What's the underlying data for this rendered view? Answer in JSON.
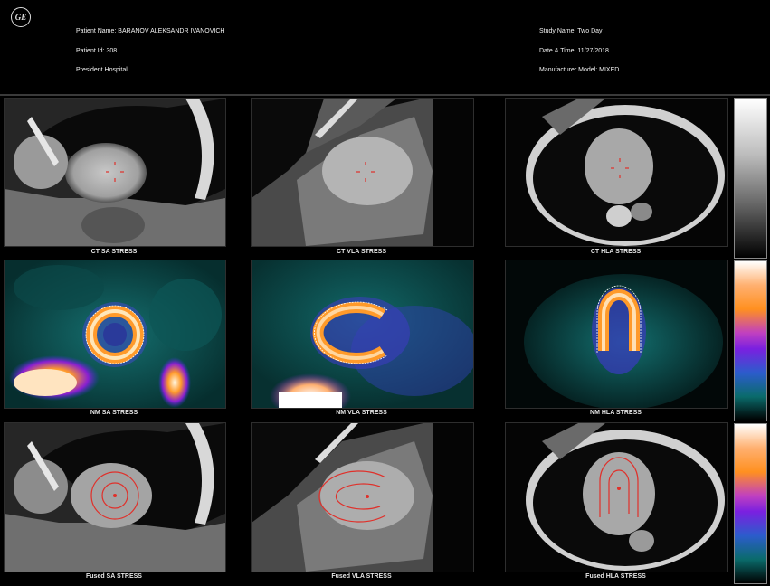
{
  "header": {
    "logo_text": "GE",
    "patient_name": "Patient Name: BARANOV ALEKSANDR IVANOVICH",
    "patient_id": "Patient Id: 308",
    "hospital": "President Hospital",
    "study_name": "Study Name: Two Day",
    "date_time": "Date & Time: 11/27/2018",
    "manufacturer_model": "Manufacturer Model: MIXED"
  },
  "viewports": {
    "ct_sa": "CT SA STRESS",
    "ct_vla": "CT VLA STRESS",
    "ct_hla": "CT HLA STRESS",
    "nm_sa": "NM SA STRESS",
    "nm_vla": "NM VLA STRESS",
    "nm_hla": "NM HLA STRESS",
    "fused_sa": "Fused SA STRESS",
    "fused_vla": "Fused VLA STRESS",
    "fused_hla": "Fused HLA STRESS"
  },
  "colorbars": [
    {
      "name": "grayscale",
      "colors": [
        "#ffffff",
        "#8a8a8a",
        "#000000"
      ]
    },
    {
      "name": "nm-heat",
      "colors": [
        "#ffffff",
        "#ff9a2a",
        "#8a1fd1",
        "#2c5ccc",
        "#0a6b6b",
        "#000000"
      ]
    },
    {
      "name": "fused-heat",
      "colors": [
        "#ffffff",
        "#ff9a2a",
        "#8a1fd1",
        "#2c5ccc",
        "#0a6b6b",
        "#000000"
      ]
    }
  ],
  "colors": {
    "background": "#000000",
    "contour": "#e0302a",
    "nm_base": "#0f5a5a",
    "nm_hot": "#ff8a20"
  }
}
